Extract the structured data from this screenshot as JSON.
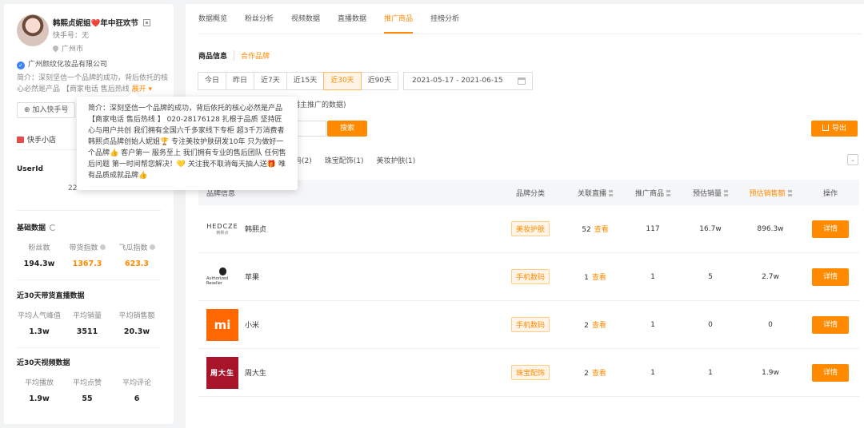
{
  "profile": {
    "name": "韩熙贞妮姐❤️年中狂欢节",
    "ks_id": "快手号：无",
    "city": "广州市",
    "company": "广州颜纹化妆品有限公司",
    "intro_short": "简介：深刻坚信一个品牌的成功，背后依托的核心必然是产品 【商家电话 售后热线",
    "expand_label": "展开 ▾",
    "follow_label": "加入快手号",
    "shop_label": "快手小店",
    "userid_label": "UserId",
    "userid_value": "22"
  },
  "tooltip_text": "简介：深刻坚信一个品牌的成功，背后依托的核心必然是产品【商家电话 售后热线 】 020-28176128 扎根于品质 坚持匠心与用户共创 我们拥有全国六千多家线下专柜 超3千万消费者 韩熙贞品牌创始人妮姐🏆 专注美妆护肤研发10年 只为做好一个品牌👍 客户第一 服务至上 我们拥有专业的售后团队 任何售后问题 第一时间帮您解决！💛 关注我不取消每天抽人送🎁 唯有品质成就品牌👍",
  "basic": {
    "title": "基础数据",
    "metrics": [
      {
        "label": "粉丝数",
        "value": "194.3w"
      },
      {
        "label": "带货指数",
        "value": "1367.3"
      },
      {
        "label": "飞瓜指数",
        "value": "623.3"
      }
    ]
  },
  "live30": {
    "title": "近30天带货直播数据",
    "metrics": [
      {
        "label": "平均人气峰值",
        "value": "1.3w"
      },
      {
        "label": "平均销量",
        "value": "3511"
      },
      {
        "label": "平均销售额",
        "value": "20.3w"
      }
    ]
  },
  "video30": {
    "title": "近30天视频数据",
    "metrics": [
      {
        "label": "平均播放",
        "value": "1.9w"
      },
      {
        "label": "平均点赞",
        "value": "55"
      },
      {
        "label": "平均评论",
        "value": "6"
      }
    ]
  },
  "tabs": [
    "数据概览",
    "粉丝分析",
    "视频数据",
    "直播数据",
    "推广商品",
    "挂榜分析"
  ],
  "subtabs": [
    "商品信息",
    "合作品牌"
  ],
  "ranges": [
    "今日",
    "昨日",
    "近7天",
    "近15天",
    "近30天",
    "近90天"
  ],
  "date_range": "2021-05-17  -  2021-06-15",
  "note": "播主推广的数据)",
  "search_label": "搜索",
  "export_label": "导出",
  "categories": [
    "码(2)",
    "珠宝配饰(1)",
    "美妆护肤(1)"
  ],
  "table": {
    "headers": [
      "品牌信息",
      "品牌分类",
      "关联直播",
      "推广商品",
      "预估销量",
      "预估销售额",
      "操作"
    ],
    "rows": [
      {
        "brand": "韩熙贞",
        "category": "美妆护肤",
        "live": "52",
        "look": "查看",
        "promo": "117",
        "sales": "16.7w",
        "amount": "896.3w",
        "op": "详情",
        "logo_text": "HEDCZE",
        "logo_sub": "韩熙贞"
      },
      {
        "brand": "苹果",
        "category": "手机数码",
        "live": "1",
        "look": "查看",
        "promo": "1",
        "sales": "5",
        "amount": "2.7w",
        "op": "详情",
        "logo_text": "Authorized Reseller",
        "logo_sub": ""
      },
      {
        "brand": "小米",
        "category": "手机数码",
        "live": "2",
        "look": "查看",
        "promo": "1",
        "sales": "0",
        "amount": "0",
        "op": "详情",
        "logo_text": "mi",
        "logo_sub": ""
      },
      {
        "brand": "周大生",
        "category": "珠宝配饰",
        "live": "2",
        "look": "查看",
        "promo": "1",
        "sales": "1",
        "amount": "1.9w",
        "op": "详情",
        "logo_text": "周大生",
        "logo_sub": ""
      }
    ]
  },
  "colors": {
    "accent": "#ff8a00",
    "heart": "#e02c3c",
    "mi": "#ff6700",
    "zds": "#a8152a"
  }
}
